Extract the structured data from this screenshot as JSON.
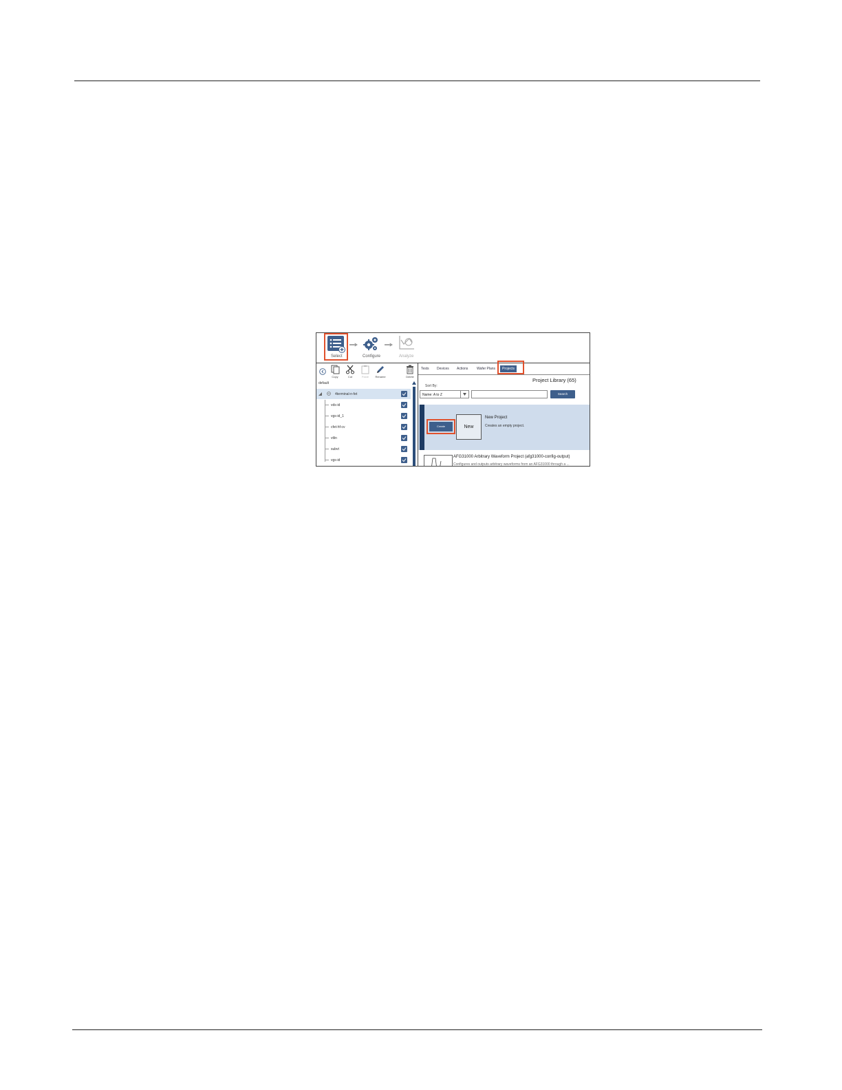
{
  "workflow": {
    "steps": [
      {
        "label": "Select",
        "icon": "select-list-icon"
      },
      {
        "label": "Configure",
        "icon": "gears-icon"
      },
      {
        "label": "Analyze",
        "icon": "analyze-chart-icon"
      }
    ]
  },
  "toolbar": {
    "copy": "Copy",
    "cut": "Cut",
    "paste": "Paste",
    "rename": "Rename",
    "delete": "Delete"
  },
  "tree": {
    "group": "default",
    "parent": "4terminal-n-fet",
    "children": [
      "vds-id",
      "vgs-id_1",
      "cfet-hf-cv",
      "vtlin",
      "subvt",
      "vgs-id"
    ]
  },
  "tabs": [
    "Tests",
    "Devices",
    "Actions",
    "Wafer Plans",
    "Projects"
  ],
  "library": {
    "title": "Project Library (65)",
    "sort_label": "Sort By:",
    "sort_value": "Name: A to Z",
    "search_button": "Search",
    "create_button": "Create",
    "new_box": "New",
    "new_title": "New Project",
    "new_desc": "Creates an empty project.",
    "item2_title": "AFG31000 Arbitrary Waveform Project (afg31000-config-output)",
    "item2_desc": "Configures and outputs arbitrary waveforms from an AFG31000 through a ..."
  },
  "colors": {
    "accent": "#3e5f8c",
    "highlight": "#e0502c",
    "selected_row": "#d6e3f1"
  }
}
